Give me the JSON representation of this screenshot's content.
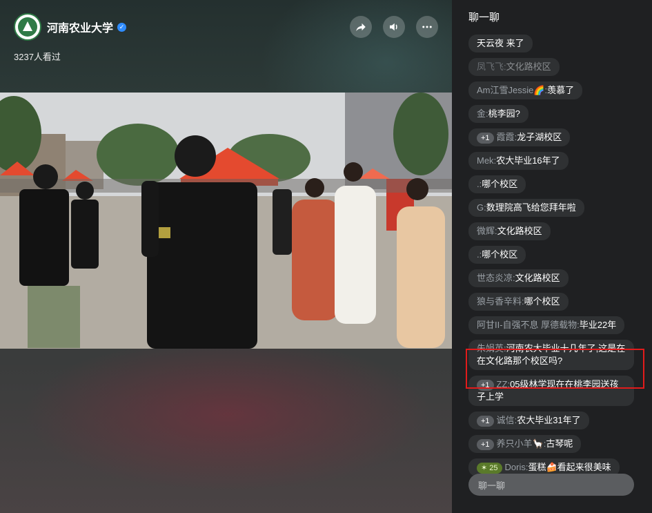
{
  "header": {
    "title": "河南农业大学",
    "views": "3237人看过"
  },
  "chat": {
    "title": "聊一聊",
    "input_placeholder": "聊一聊",
    "messages": [
      {
        "user": "",
        "text": "天云夜 来了",
        "faded": false
      },
      {
        "user": "凤飞飞",
        "text": "文化路校区",
        "faded": true
      },
      {
        "user": "Am江雪Jessie🌈",
        "text": "羡慕了"
      },
      {
        "user": "金",
        "text": "桃李园?"
      },
      {
        "badge": "+1",
        "user": "霞霞",
        "text": "龙子湖校区"
      },
      {
        "user": "Mek",
        "text": "农大毕业16年了"
      },
      {
        "user": ".",
        "text": "哪个校区"
      },
      {
        "user": "G",
        "text": "数理院高飞给您拜年啦"
      },
      {
        "user": "微辉",
        "text": "文化路校区"
      },
      {
        "user": ".",
        "text": "哪个校区"
      },
      {
        "user": "世态炎凉",
        "text": "文化路校区"
      },
      {
        "user": "狼与香辛料",
        "text": "哪个校区"
      },
      {
        "user": "阿甘II-自强不息 厚德载物",
        "text": "毕业22年"
      },
      {
        "user": "朱娟英",
        "text": "河南农大毕业十几年了,这是在在文化路那个校区吗?"
      },
      {
        "badge": "+1",
        "user": "ZZ",
        "text": "05级林学现在在桃李园送孩子上学"
      },
      {
        "badge": "+1",
        "user": "诚信",
        "text": "农大毕业31年了"
      },
      {
        "badge": "+1",
        "user": "养只小羊🦙",
        "text": "古琴呢"
      },
      {
        "badge": "25",
        "user": "Doris",
        "text": "蛋糕🍰看起来很美味"
      }
    ]
  },
  "colors": {
    "highlight": "#e21b1b",
    "verified": "#2f8cff"
  }
}
